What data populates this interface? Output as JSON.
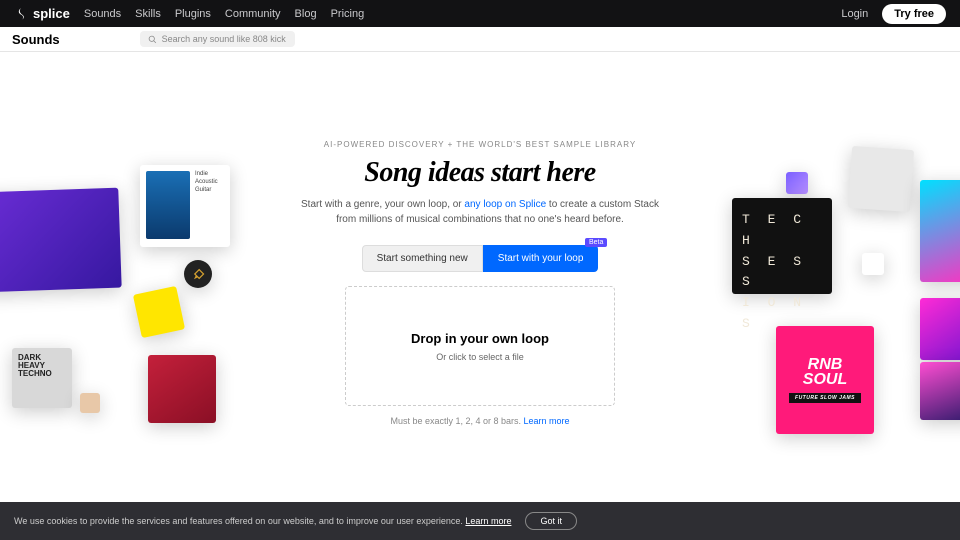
{
  "nav": {
    "brand": "splice",
    "links": [
      "Sounds",
      "Skills",
      "Plugins",
      "Community",
      "Blog",
      "Pricing"
    ],
    "login": "Login",
    "cta": "Try free"
  },
  "subnav": {
    "title": "Sounds",
    "search_placeholder": "Search any sound like 808 kick"
  },
  "hero": {
    "overline": "AI-POWERED DISCOVERY + THE WORLD'S BEST SAMPLE LIBRARY",
    "headline": "Song ideas start here",
    "subcopy_pre": "Start with a genre, your own loop, or ",
    "subcopy_link": "any loop on Splice",
    "subcopy_post": " to create a custom Stack from millions of musical combinations that no one's heard before.",
    "btn_secondary": "Start something new",
    "btn_primary": "Start with your loop",
    "beta": "Beta",
    "drop_title": "Drop in your own loop",
    "drop_sub": "Or click to select a file",
    "footnote_pre": "Must be exactly 1, 2, 4 or 8 bars. ",
    "footnote_link": "Learn more"
  },
  "art": {
    "indie_label": "Indie\nAcoustic\nGuitar",
    "techno": "DARK\nHEAVY\nTECHNO",
    "tech_sessions": "T E C H\nS E S S\nI O N S",
    "rnb_main": "RNB\nSOUL",
    "rnb_sub": "FUTURE SLOW JAMS"
  },
  "cookie": {
    "text": "We use cookies to provide the services and features offered on our website, and to improve our user experience. ",
    "learn": "Learn more",
    "btn": "Got it"
  }
}
